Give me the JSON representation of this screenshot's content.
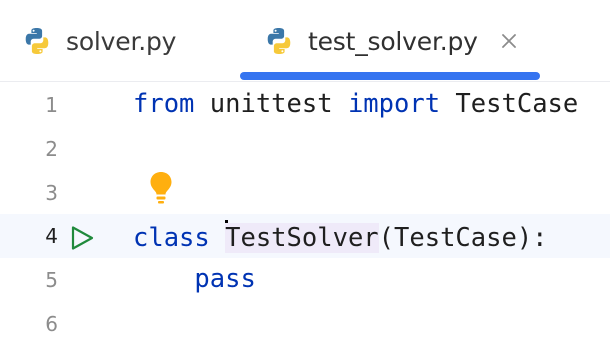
{
  "tabs": [
    {
      "label": "solver.py",
      "icon": "python-file-icon",
      "active": false
    },
    {
      "label": "test_solver.py",
      "icon": "python-file-icon",
      "active": true,
      "closable": true
    }
  ],
  "editor": {
    "lines": [
      {
        "number": "1",
        "tokens": [
          {
            "text": "from",
            "kw": true
          },
          {
            "text": " unittest ",
            "kw": false
          },
          {
            "text": "import",
            "kw": true
          },
          {
            "text": " TestCase",
            "kw": false
          }
        ]
      },
      {
        "number": "2",
        "tokens": []
      },
      {
        "number": "3",
        "tokens": []
      },
      {
        "number": "4",
        "tokens": [
          {
            "text": "class",
            "kw": true
          },
          {
            "text": " ",
            "kw": false
          },
          {
            "text": "TestSolver",
            "kw": false,
            "highlight": true,
            "cursor_before": true
          },
          {
            "text": "(TestCase):",
            "kw": false
          }
        ]
      },
      {
        "number": "5",
        "tokens": [
          {
            "text": "    ",
            "kw": false
          },
          {
            "text": "pass",
            "kw": true
          }
        ]
      },
      {
        "number": "6",
        "tokens": []
      }
    ],
    "current_line": "4"
  },
  "gutter": {
    "intention_icon": "lightbulb-icon",
    "run_icon": "run-gutter-icon"
  },
  "colors": {
    "keyword": "#0033b3",
    "tab_underline": "#3574f0",
    "caret_line": "#f5f8fe",
    "line_number": "#8c8c8c",
    "line_number_current": "#1f1f1f",
    "bulb": "#ffaf0f",
    "run": "#208a3c",
    "identifier_highlight": "#efeaf9"
  }
}
